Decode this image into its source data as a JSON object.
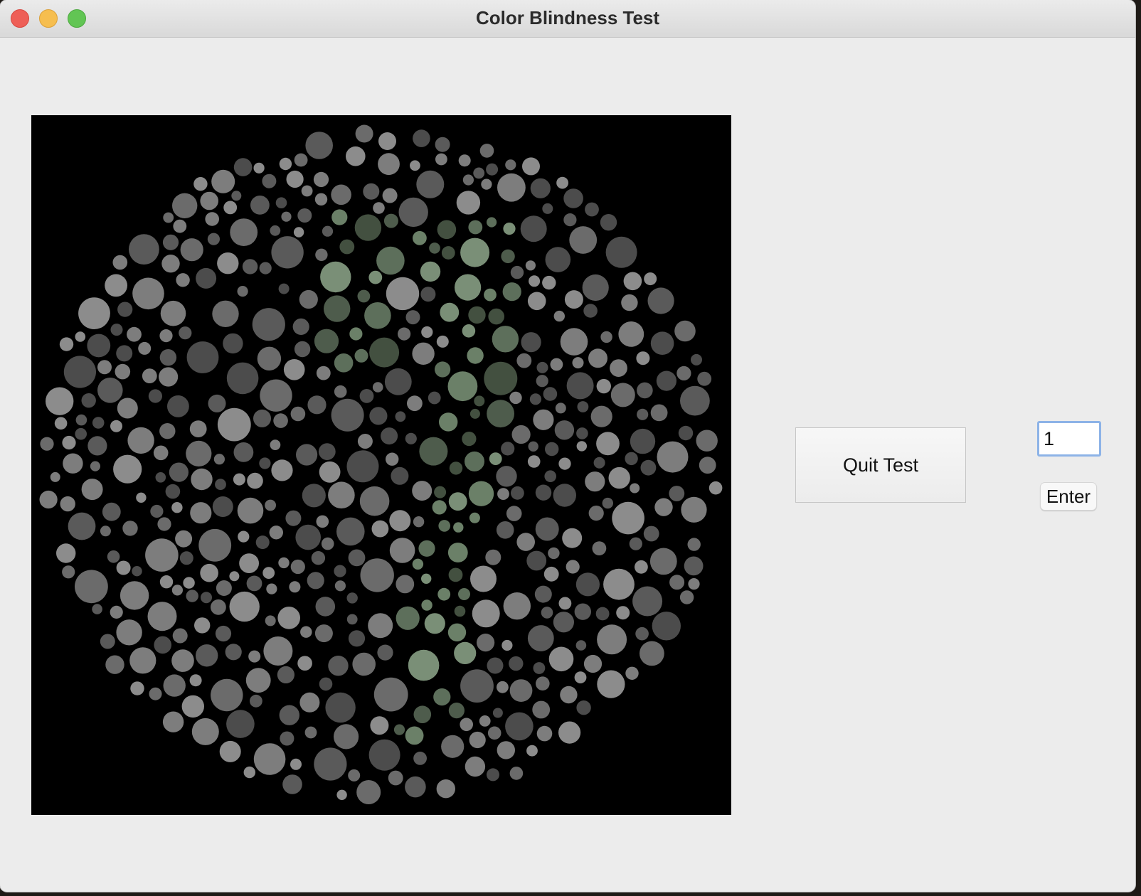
{
  "window": {
    "title": "Color Blindness Test"
  },
  "plate": {
    "background_color": "#000000",
    "dot_colors_background": [
      "#5a5a5a",
      "#6b6b6b",
      "#7d7d7d",
      "#8c8c8c",
      "#4c4c4c"
    ],
    "dot_colors_figure": [
      "#4e5c4c",
      "#5d6f5b",
      "#6b8068",
      "#7a8f77",
      "#435040"
    ]
  },
  "controls": {
    "quit_label": "Quit Test",
    "answer_value": "1",
    "enter_label": "Enter"
  },
  "colors": {
    "close": "#ee5f57",
    "minimize": "#f6be4f",
    "maximize": "#62c554",
    "input_focus": "#8db3e7"
  },
  "icons": {
    "close": "close-icon",
    "minimize": "minimize-icon",
    "maximize": "maximize-icon"
  }
}
